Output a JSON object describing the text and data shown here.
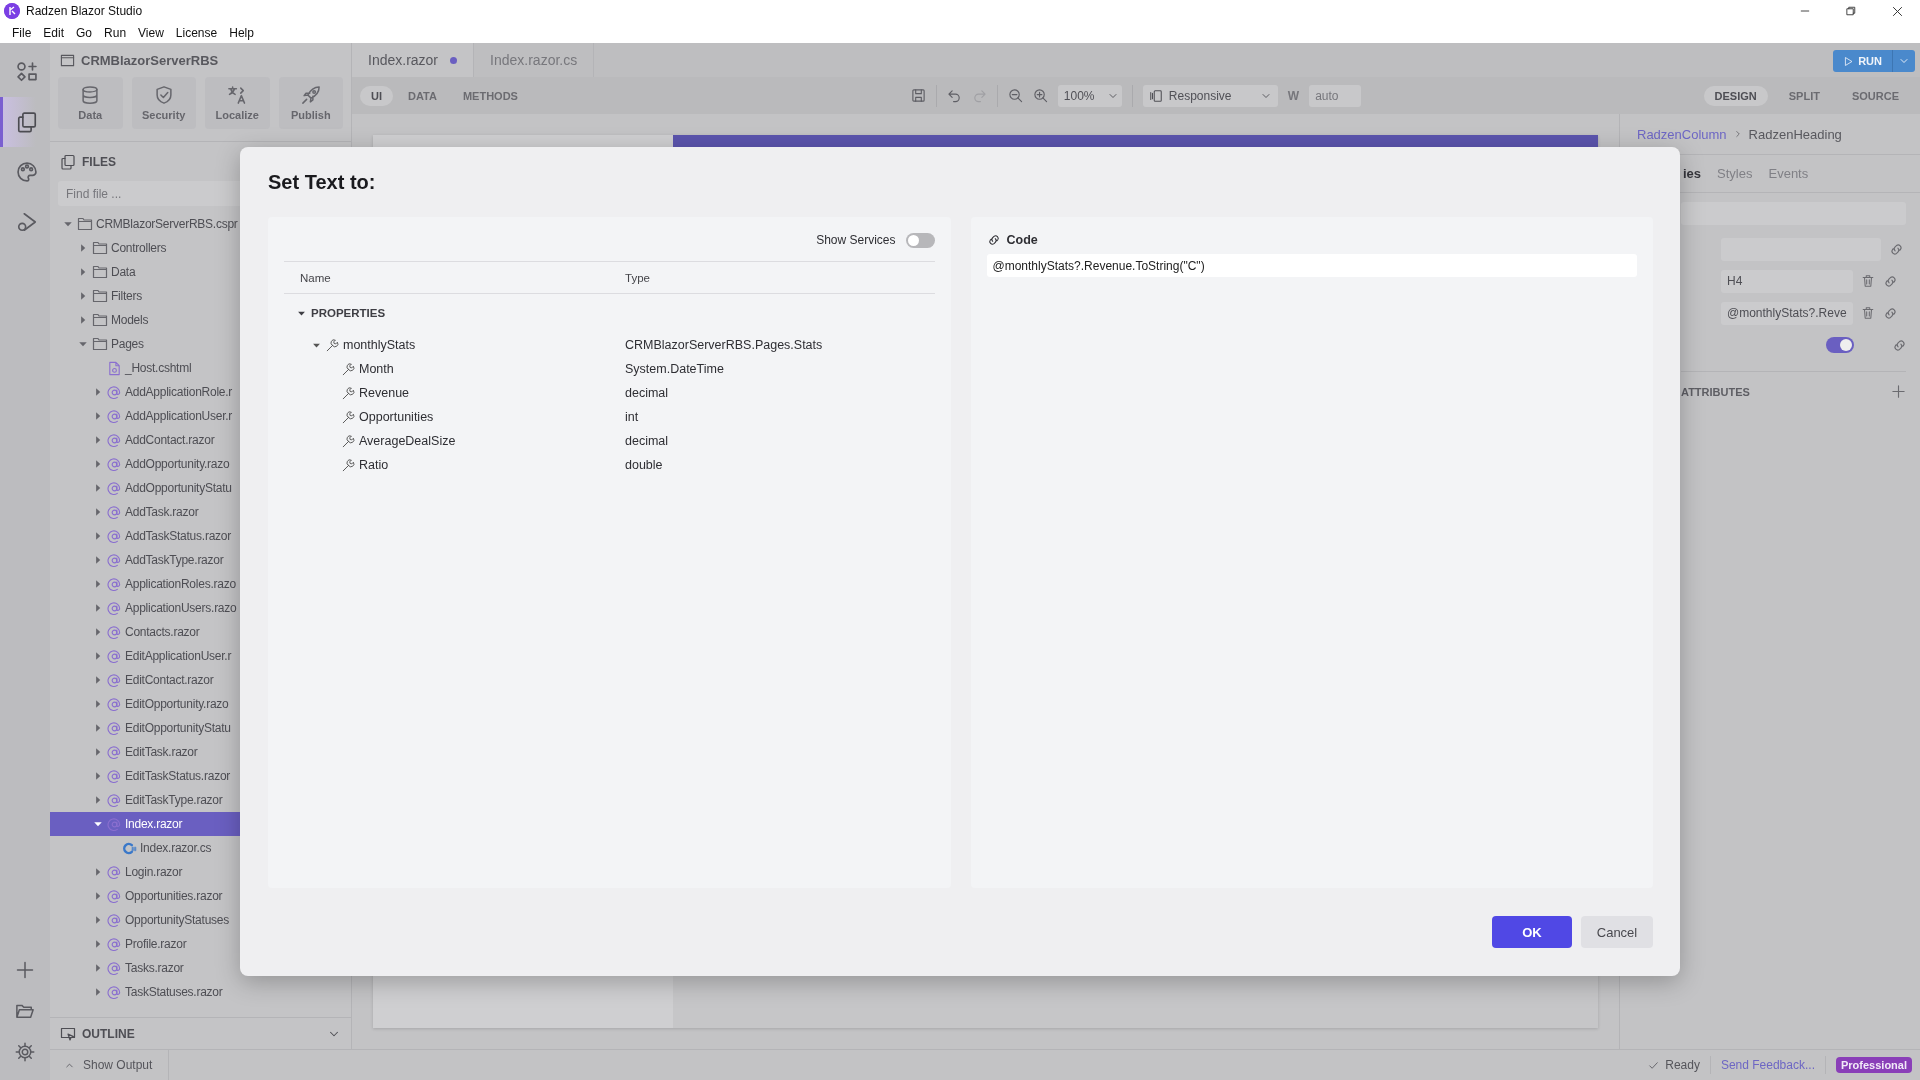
{
  "window": {
    "title": "Radzen Blazor Studio"
  },
  "menu": [
    "File",
    "Edit",
    "Go",
    "Run",
    "View",
    "License",
    "Help"
  ],
  "activity_bar": {
    "items": [
      {
        "kind": "toolbox",
        "selected": false
      },
      {
        "kind": "files",
        "selected": true
      },
      {
        "kind": "palette",
        "selected": false
      },
      {
        "kind": "debug",
        "selected": false
      }
    ],
    "bottom": [
      {
        "kind": "plus"
      },
      {
        "kind": "folderopen"
      },
      {
        "kind": "gear"
      }
    ]
  },
  "project": {
    "name": "CRMBlazorServerRBS",
    "actions": [
      {
        "kind": "database",
        "label": "Data"
      },
      {
        "kind": "shield",
        "label": "Security"
      },
      {
        "kind": "translate",
        "label": "Localize"
      },
      {
        "kind": "rocket",
        "label": "Publish"
      }
    ]
  },
  "files": {
    "title": "FILES",
    "search": {
      "placeholder": "Find file ..."
    },
    "tree": [
      {
        "label": "CRMBlazorServerRBS.cspr",
        "kind": "folder",
        "expanded": true,
        "selected": false,
        "children": [
          {
            "label": "Controllers",
            "kind": "folder",
            "expanded": false,
            "selected": false
          },
          {
            "label": "Data",
            "kind": "folder",
            "expanded": false,
            "selected": false
          },
          {
            "label": "Filters",
            "kind": "folder",
            "expanded": false,
            "selected": false
          },
          {
            "label": "Models",
            "kind": "folder",
            "expanded": false,
            "selected": false
          },
          {
            "label": "Pages",
            "kind": "folder",
            "expanded": true,
            "selected": false,
            "children": [
              {
                "label": "_Host.cshtml",
                "kind": "file",
                "selected": false
              },
              {
                "label": "AddApplicationRole.r",
                "kind": "razor",
                "expanded": false,
                "selected": false
              },
              {
                "label": "AddApplicationUser.r",
                "kind": "razor",
                "expanded": false,
                "selected": false
              },
              {
                "label": "AddContact.razor",
                "kind": "razor",
                "expanded": false,
                "selected": false
              },
              {
                "label": "AddOpportunity.razo",
                "kind": "razor",
                "expanded": false,
                "selected": false
              },
              {
                "label": "AddOpportunityStatu",
                "kind": "razor",
                "expanded": false,
                "selected": false
              },
              {
                "label": "AddTask.razor",
                "kind": "razor",
                "expanded": false,
                "selected": false
              },
              {
                "label": "AddTaskStatus.razor",
                "kind": "razor",
                "expanded": false,
                "selected": false
              },
              {
                "label": "AddTaskType.razor",
                "kind": "razor",
                "expanded": false,
                "selected": false
              },
              {
                "label": "ApplicationRoles.razo",
                "kind": "razor",
                "expanded": false,
                "selected": false
              },
              {
                "label": "ApplicationUsers.razo",
                "kind": "razor",
                "expanded": false,
                "selected": false
              },
              {
                "label": "Contacts.razor",
                "kind": "razor",
                "expanded": false,
                "selected": false
              },
              {
                "label": "EditApplicationUser.r",
                "kind": "razor",
                "expanded": false,
                "selected": false
              },
              {
                "label": "EditContact.razor",
                "kind": "razor",
                "expanded": false,
                "selected": false
              },
              {
                "label": "EditOpportunity.razo",
                "kind": "razor",
                "expanded": false,
                "selected": false
              },
              {
                "label": "EditOpportunityStatu",
                "kind": "razor",
                "expanded": false,
                "selected": false
              },
              {
                "label": "EditTask.razor",
                "kind": "razor",
                "expanded": false,
                "selected": false
              },
              {
                "label": "EditTaskStatus.razor",
                "kind": "razor",
                "expanded": false,
                "selected": false
              },
              {
                "label": "EditTaskType.razor",
                "kind": "razor",
                "expanded": false,
                "selected": false
              },
              {
                "label": "Index.razor",
                "kind": "razor",
                "expanded": true,
                "selected": true,
                "children": [
                  {
                    "label": "Index.razor.cs",
                    "kind": "csharp",
                    "selected": false
                  }
                ]
              },
              {
                "label": "Login.razor",
                "kind": "razor",
                "expanded": false,
                "selected": false
              },
              {
                "label": "Opportunities.razor",
                "kind": "razor",
                "expanded": false,
                "selected": false
              },
              {
                "label": "OpportunityStatuses",
                "kind": "razor",
                "expanded": false,
                "selected": false
              },
              {
                "label": "Profile.razor",
                "kind": "razor",
                "expanded": false,
                "selected": false
              },
              {
                "label": "Tasks.razor",
                "kind": "razor",
                "expanded": false,
                "selected": false
              },
              {
                "label": "TaskStatuses.razor",
                "kind": "razor",
                "expanded": false,
                "selected": false
              }
            ]
          }
        ]
      }
    ]
  },
  "outline": {
    "title": "OUTLINE",
    "expanded": false
  },
  "editor": {
    "tabs": [
      {
        "label": "Index.razor",
        "selected": true,
        "modified": true
      },
      {
        "label": "Index.razor.cs",
        "selected": false,
        "modified": false
      }
    ],
    "run": {
      "label": "RUN"
    },
    "modes": [
      {
        "label": "UI",
        "selected": true
      },
      {
        "label": "DATA",
        "selected": false
      },
      {
        "label": "METHODS",
        "selected": false
      }
    ],
    "history": {
      "undo_enabled": true,
      "redo_enabled": false
    },
    "zoom": "100%",
    "device": "Responsive",
    "width_label": "W",
    "width": "auto",
    "views": [
      {
        "label": "DESIGN",
        "selected": true
      },
      {
        "label": "SPLIT",
        "selected": false
      },
      {
        "label": "SOURCE",
        "selected": false
      }
    ]
  },
  "properties_panel": {
    "breadcrumb": [
      {
        "label": "RadzenColumn",
        "kind": "link"
      },
      {
        "label": "RadzenHeading",
        "kind": "current"
      }
    ],
    "tabs": [
      {
        "label": "ies",
        "selected": true
      },
      {
        "label": "Styles",
        "selected": false
      },
      {
        "label": "Events",
        "selected": false
      }
    ],
    "fields": [
      {
        "kind": "wide"
      },
      {
        "kind": "text",
        "clearable": false
      },
      {
        "kind": "text",
        "value": "H4",
        "clearable": true
      },
      {
        "kind": "text",
        "value": "@monthlyStats?.Reve",
        "clearable": true
      },
      {
        "kind": "switch",
        "on": true
      }
    ],
    "section": "ATTRIBUTES"
  },
  "status_bar": {
    "output": "Show Output",
    "status": "Ready",
    "feedback": "Send Feedback...",
    "edition": "Professional"
  },
  "dialog": {
    "title": "Set Text to:",
    "show_services": {
      "label": "Show Services",
      "on": false
    },
    "columns": [
      "Name",
      "Type"
    ],
    "group": {
      "label": "PROPERTIES",
      "expanded": true
    },
    "properties": [
      {
        "name": "monthlyStats",
        "type": "CRMBlazorServerRBS.Pages.Stats",
        "expanded": true,
        "children": [
          {
            "name": "Month",
            "type": "System.DateTime"
          },
          {
            "name": "Revenue",
            "type": "decimal"
          },
          {
            "name": "Opportunities",
            "type": "int"
          },
          {
            "name": "AverageDealSize",
            "type": "decimal"
          },
          {
            "name": "Ratio",
            "type": "double"
          }
        ]
      }
    ],
    "code": {
      "title": "Code",
      "value": "@monthlyStats?.Revenue.ToString(\"C\")"
    },
    "buttons": [
      {
        "kind": "primary",
        "label": "OK"
      },
      {
        "kind": "secondary",
        "label": "Cancel"
      }
    ]
  }
}
